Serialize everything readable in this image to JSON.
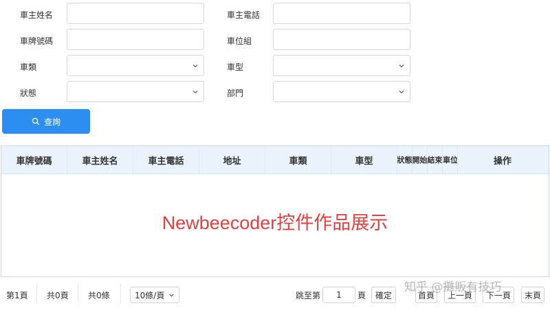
{
  "form": {
    "owner_name_label": "車主姓名",
    "owner_phone_label": "車主電話",
    "plate_label": "車牌號碼",
    "parking_group_label": "車位組",
    "vehicle_category_label": "車類",
    "vehicle_model_label": "車型",
    "status_label": "狀態",
    "department_label": "部門",
    "owner_name_value": "",
    "owner_phone_value": "",
    "plate_value": "",
    "parking_group_value": "",
    "vehicle_category_value": "",
    "vehicle_model_value": "",
    "status_value": "",
    "department_value": ""
  },
  "query_button": {
    "label": "查詢",
    "icon": "search-icon",
    "color": "#2b8ef0"
  },
  "table": {
    "columns": [
      "車牌號碼",
      "車主姓名",
      "車主電話",
      "地址",
      "車類",
      "車型",
      "狀態",
      "開始",
      "結束",
      "車位餘額",
      "操作"
    ],
    "header_bg": "#eaf3fc"
  },
  "watermark": "Newbeecoder控件作品展示",
  "pager": {
    "current_page": "第1頁",
    "total_pages": "共0頁",
    "total_items": "共0條",
    "page_size": "10條/頁",
    "jump_label": "跳至第",
    "jump_value": "1",
    "page_unit": "頁",
    "confirm": "確定",
    "first": "首頁",
    "prev": "上一頁",
    "next": "下一頁",
    "last": "末頁"
  },
  "zhihu_watermark": "知乎 @攤販有技巧"
}
